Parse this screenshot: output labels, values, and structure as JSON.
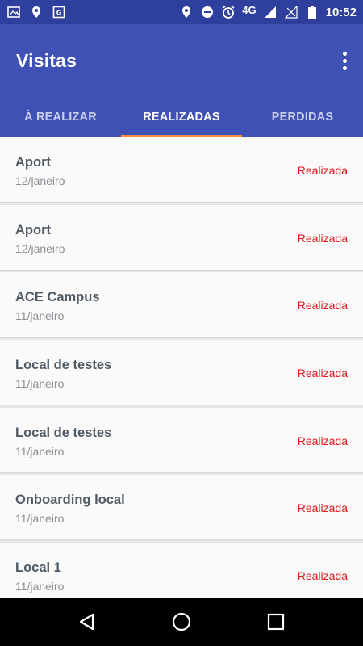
{
  "status_bar": {
    "network": "4G",
    "time": "10:52",
    "icons": [
      "image-icon",
      "location-icon",
      "app-icon",
      "location-icon",
      "do-not-disturb-icon",
      "alarm-icon",
      "signal-icon",
      "battery-icon"
    ]
  },
  "app_bar": {
    "title": "Visitas",
    "overflow_icon": "more-vert-icon"
  },
  "tabs": [
    {
      "label": "À REALIZAR",
      "active": false
    },
    {
      "label": "REALIZADAS",
      "active": true
    },
    {
      "label": "PERDIDAS",
      "active": false
    }
  ],
  "visits": [
    {
      "name": "Aport",
      "date": "12/janeiro",
      "status": "Realizada"
    },
    {
      "name": "Aport",
      "date": "12/janeiro",
      "status": "Realizada"
    },
    {
      "name": "ACE Campus",
      "date": "11/janeiro",
      "status": "Realizada"
    },
    {
      "name": "Local de testes",
      "date": "11/janeiro",
      "status": "Realizada"
    },
    {
      "name": "Local de testes",
      "date": "11/janeiro",
      "status": "Realizada"
    },
    {
      "name": "Onboarding local",
      "date": "11/janeiro",
      "status": "Realizada"
    },
    {
      "name": "Local 1",
      "date": "11/janeiro",
      "status": "Realizada"
    }
  ],
  "nav_bar": {
    "icons": [
      "back-icon",
      "home-icon",
      "recents-icon"
    ]
  },
  "colors": {
    "primary": "#3f51b5",
    "status_bar": "#2f3f9e",
    "tab_indicator": "#ff8a3d",
    "status_text": "#e8151b"
  }
}
